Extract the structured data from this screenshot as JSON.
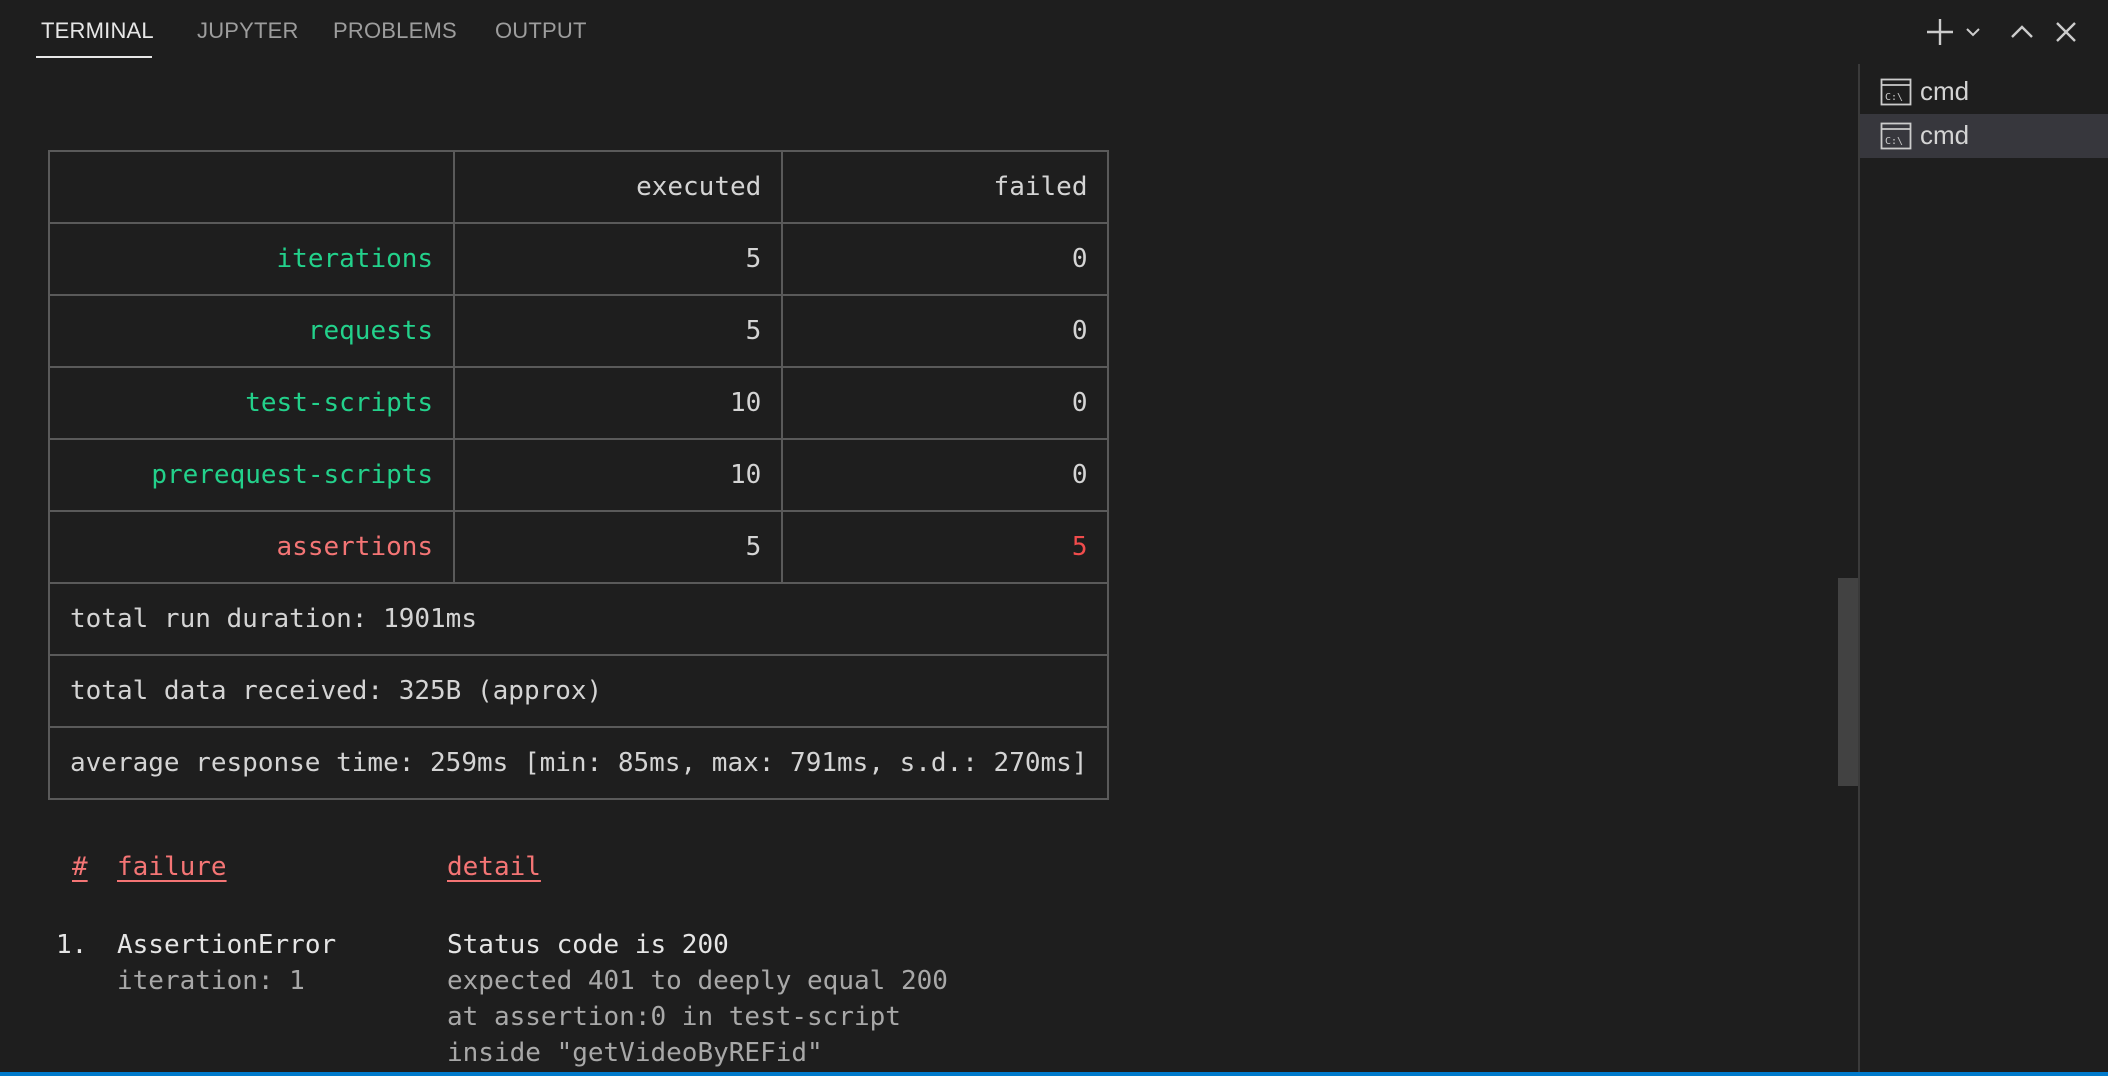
{
  "tabs": [
    {
      "label": "TERMINAL",
      "active": true
    },
    {
      "label": "JUPYTER",
      "active": false
    },
    {
      "label": "PROBLEMS",
      "active": false
    },
    {
      "label": "OUTPUT",
      "active": false
    }
  ],
  "toolbar_icons": [
    "plus-icon",
    "chevron-down-icon",
    "chevron-up-icon",
    "close-icon"
  ],
  "terminals": [
    {
      "label": "cmd",
      "icon": "cmd-terminal-icon",
      "selected": false
    },
    {
      "label": "cmd",
      "icon": "cmd-terminal-icon",
      "selected": true
    }
  ],
  "summary": {
    "headers": [
      "",
      "executed",
      "failed"
    ],
    "rows": [
      {
        "label": "iterations",
        "executed": "5",
        "failed": "0"
      },
      {
        "label": "requests",
        "executed": "5",
        "failed": "0"
      },
      {
        "label": "test-scripts",
        "executed": "10",
        "failed": "0"
      },
      {
        "label": "prerequest-scripts",
        "executed": "10",
        "failed": "0"
      },
      {
        "label": "assertions",
        "executed": "5",
        "failed": "5"
      }
    ],
    "total_run_duration": "total run duration: 1901ms",
    "total_data_received": "total data received: 325B (approx)",
    "average_response_time": "average response time: 259ms [min: 85ms, max: 791ms, s.d.: 270ms]"
  },
  "failures": {
    "headers": {
      "num": "#",
      "failure": "failure",
      "detail": "detail"
    },
    "items": [
      {
        "index": "1.",
        "type": "AssertionError",
        "iteration": "iteration: 1",
        "title": "Status code is 200",
        "details": [
          "expected 401 to deeply equal 200",
          "at assertion:0 in test-script",
          "inside \"getVideoByREFid\""
        ]
      }
    ]
  },
  "colors": {
    "background": "#1e1e1e",
    "pass_green": "#23d18b",
    "fail_red": "#f14c4c",
    "accent_blue": "#007acc"
  }
}
